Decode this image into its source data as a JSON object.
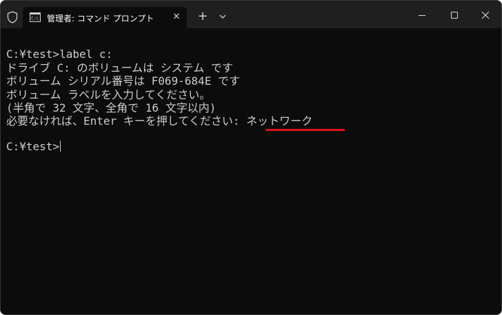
{
  "titlebar": {
    "tab_title": "管理者: コマンド プロンプト",
    "tab_icon": "cmd-icon",
    "shield_icon": "shield-icon"
  },
  "terminal": {
    "lines": [
      "C:¥test>label c:",
      "ドライブ C: のボリュームは システム です",
      "ボリューム シリアル番号は F069-684E です",
      "ボリューム ラベルを入力してください。",
      "(半角で 32 文字、全角で 16 文字以内)",
      "必要なければ、Enter キーを押してください: ネットワーク",
      "",
      "C:¥test>"
    ],
    "highlight_text": "ネットワーク"
  },
  "colors": {
    "background": "#0c0c0c",
    "titlebar": "#1f1f1f",
    "text": "#cccccc",
    "underline": "#e0101c"
  }
}
